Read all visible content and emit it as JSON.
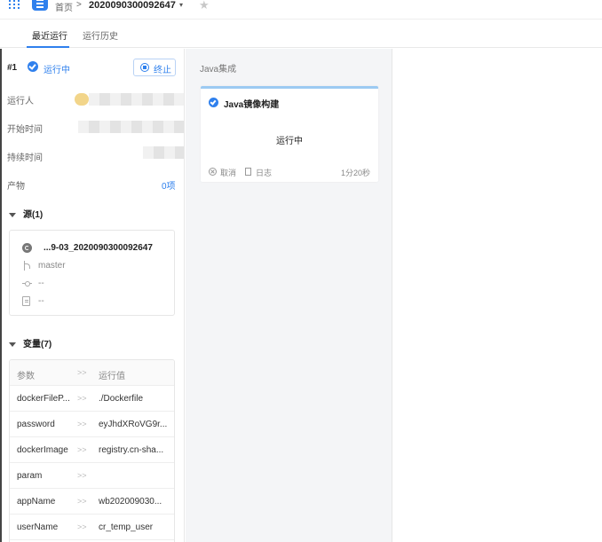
{
  "breadcrumb": {
    "home": "首页",
    "separator": ">",
    "current": "2020090300092647",
    "caret": "▾",
    "star": "★"
  },
  "tabs": [
    {
      "label": "最近运行",
      "active": true
    },
    {
      "label": "运行历史",
      "active": false
    }
  ],
  "run": {
    "number": "#1",
    "status": "运行中",
    "stop_label": "终止"
  },
  "info": {
    "runner_label": "运行人",
    "start_label": "开始时间",
    "duration_label": "持续时间",
    "artifacts_label": "产物",
    "artifacts_value": "0项"
  },
  "source": {
    "title": "源(1)",
    "repo": "...9-03_2020090300092647",
    "branch": "master",
    "commit": "--",
    "message": "--"
  },
  "variables": {
    "title": "变量(7)",
    "header": {
      "param": "参数",
      "arrow": ">>",
      "value": "运行值"
    },
    "rows": [
      {
        "param": "dockerFileP...",
        "arrow": ">>",
        "value": "./Dockerfile"
      },
      {
        "param": "password",
        "arrow": ">>",
        "value": "eyJhdXRoVG9r..."
      },
      {
        "param": "dockerImage",
        "arrow": ">>",
        "value": "registry.cn-sha..."
      },
      {
        "param": "param",
        "arrow": ">>",
        "value": ""
      },
      {
        "param": "appName",
        "arrow": ">>",
        "value": "wb202009030..."
      },
      {
        "param": "userName",
        "arrow": ">>",
        "value": "cr_temp_user"
      }
    ]
  },
  "stage": {
    "title": "Java集成",
    "job": {
      "name": "Java镜像构建",
      "state": "运行中",
      "cancel_label": "取消",
      "log_label": "日志",
      "duration": "1分20秒"
    }
  },
  "colors": {
    "accent": "#2f80ed",
    "stage_bg": "#f4f5f7",
    "job_top_border": "#9ccaf2"
  }
}
